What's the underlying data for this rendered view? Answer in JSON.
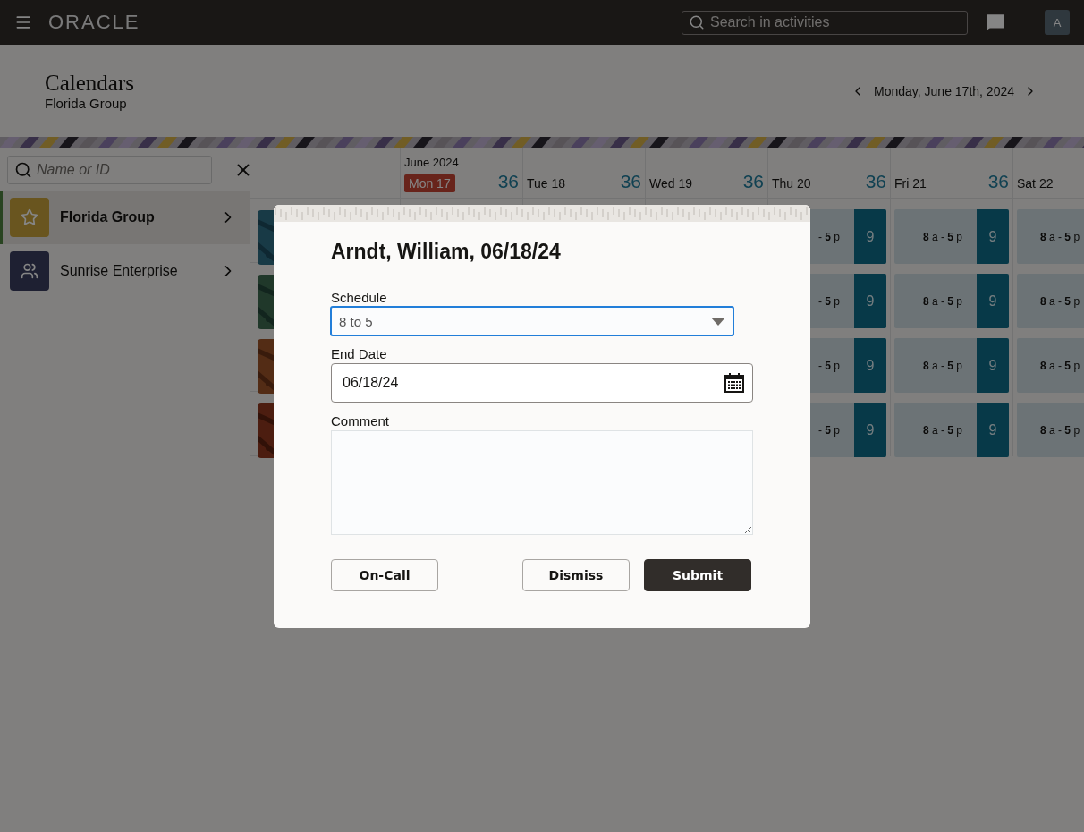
{
  "topbar": {
    "logo": "ORACLE",
    "search": {
      "placeholder": "Search in activities"
    },
    "avatar": "A"
  },
  "header": {
    "title": "Calendars",
    "subtitle": "Florida Group",
    "date": "Monday, June 17th, 2024"
  },
  "sidebar": {
    "search": {
      "placeholder": "Name or ID"
    },
    "items": [
      {
        "label": "Florida Group",
        "kind": "starred",
        "selected": true
      },
      {
        "label": "Sunrise Enterprise",
        "kind": "team",
        "selected": false
      }
    ]
  },
  "calendar": {
    "month": "June 2024",
    "days": [
      {
        "label": "Mon 17",
        "count": "36",
        "today": true
      },
      {
        "label": "Tue 18",
        "count": "36",
        "today": false
      },
      {
        "label": "Wed 19",
        "count": "36",
        "today": false
      },
      {
        "label": "Thu 20",
        "count": "36",
        "today": false
      },
      {
        "label": "Fri 21",
        "count": "36",
        "today": false
      },
      {
        "label": "Sat 22",
        "today": false
      }
    ],
    "rows": [
      {
        "avatar": {
          "kind": "picture"
        },
        "cells": [
          {
            "time": "- **5** p",
            "hours": "9"
          },
          {
            "time": "**8** a - **5** p",
            "hours": "9"
          },
          {
            "time": "**8** a - **5** p"
          }
        ]
      },
      {
        "avatar": {
          "kind": "picture"
        },
        "cells": [
          {
            "time": "- **5** p",
            "hours": "9"
          },
          {
            "time": "**8** a - **5** p",
            "hours": "9"
          },
          {
            "time": "**8** a - **5** p"
          }
        ]
      },
      {
        "avatar": {
          "kind": "picture"
        },
        "cells": [
          {
            "time": "- **5** p",
            "hours": "9"
          },
          {
            "time": "**8** a - **5** p",
            "hours": "9"
          },
          {
            "time": "**8** a - **5** p"
          }
        ]
      },
      {
        "avatar": {
          "kind": "picture"
        },
        "cells": [
          {
            "time": "- **5** p",
            "hours": "9"
          },
          {
            "time": "**8** a - **5** p",
            "hours": "9"
          },
          {
            "time": "**8** a - **5** p"
          }
        ]
      }
    ]
  },
  "dialog": {
    "title": "Arndt, William, 06/18/24",
    "schedule": {
      "label": "Schedule",
      "value": "8 to 5",
      "focused": true
    },
    "end_date": {
      "label": "End Date",
      "value": "06/18/24"
    },
    "comment": {
      "label": "Comment"
    },
    "buttons": [
      {
        "label": "On-Call",
        "kind": "secondary"
      },
      {
        "label": "Dismiss",
        "kind": "secondary"
      },
      {
        "label": "Submit",
        "kind": "primary"
      }
    ]
  }
}
